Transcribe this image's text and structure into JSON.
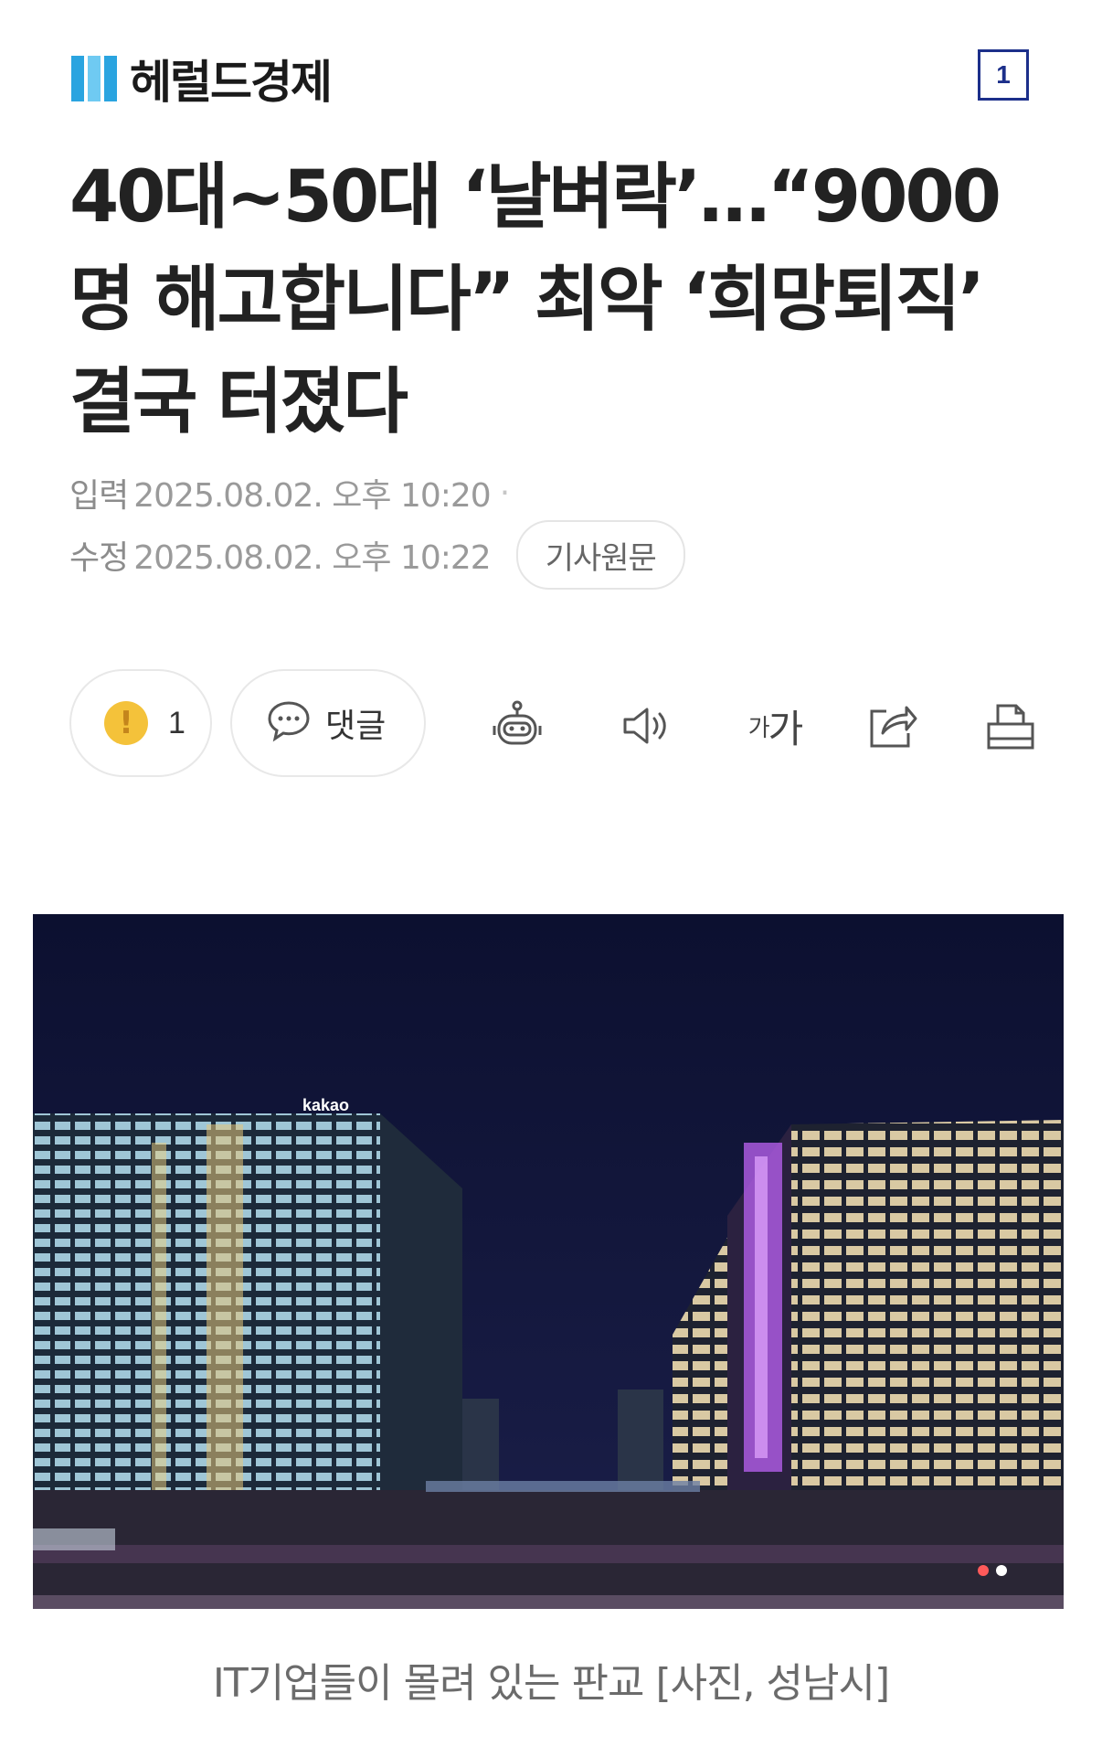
{
  "header": {
    "logo_text": "헤럴드경제",
    "page_number": "1"
  },
  "article": {
    "title": "40대~50대 ‘날벼락’…“9000명 해고합니다” 최악 ‘희망퇴직’ 결국 터졌다",
    "published_label": "입력",
    "published_value": "2025.08.02. 오후 10:20",
    "modified_label": "수정",
    "modified_value": "2025.08.02. 오후 10:22",
    "original_button": "기사원문"
  },
  "toolbar": {
    "reaction_count": "1",
    "comment_label": "댓글",
    "font_size_label_small": "가",
    "font_size_label_large": "가"
  },
  "photo": {
    "sign_text": "kakao",
    "caption": "IT기업들이 몰려 있는 판교 [사진, 성남시]"
  },
  "colors": {
    "logo_blue": "#2aa4e0",
    "page_badge": "#1c2f8a",
    "reaction_yellow": "#f4c23a",
    "night_sky": "#101436",
    "neon_purple": "#b35ee8"
  }
}
